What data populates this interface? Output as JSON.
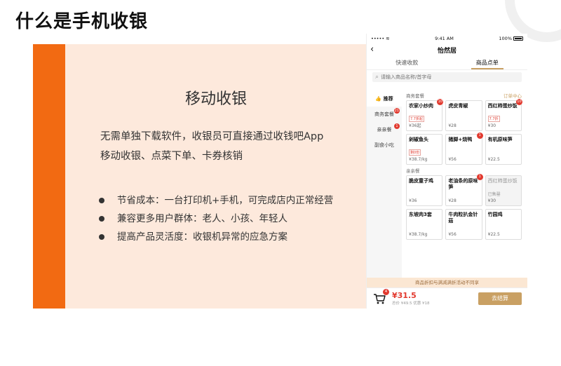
{
  "slide": {
    "title": "什么是手机收银"
  },
  "panel": {
    "heading": "移动收银",
    "desc_line1": "无需单独下载软件，收银员可直接通过收钱吧App",
    "desc_line2": "移动收银、点菜下单、卡券核销",
    "bullets": [
      "节省成本：一台打印机+手机，可完成店内正常经营",
      "兼容更多用户群体：老人、小孩、年轻人",
      "提高产品灵活度：收银机异常的应急方案"
    ]
  },
  "phone": {
    "status": {
      "carrier": "•••••",
      "time": "9:41 AM",
      "battery": "100%"
    },
    "nav": {
      "back": "‹",
      "title": "怡然居"
    },
    "tabs": [
      {
        "label": "快速收款"
      },
      {
        "label": "商品点单"
      }
    ],
    "search_placeholder": "请输入商品名称/首字母",
    "categories": [
      {
        "label": "推荐",
        "badge": ""
      },
      {
        "label": "商务套餐",
        "badge": "21"
      },
      {
        "label": "亲亲餐",
        "badge": "1"
      },
      {
        "label": "副食小吃",
        "badge": ""
      }
    ],
    "section1": {
      "title": "商务套餐",
      "link": "订单中心",
      "items": [
        {
          "name": "农家小炒肉",
          "tag": "7.7折起",
          "price": "¥36起",
          "badge": "10"
        },
        {
          "name": "虎皮青椒",
          "tag": "",
          "price": "¥28",
          "badge": ""
        },
        {
          "name": "西红柿蛋炒饭",
          "tag": "7.7折",
          "price": "¥30",
          "badge": "10"
        },
        {
          "name": "剁椒鱼头",
          "tag": "剩0份",
          "price": "¥38.7/kg",
          "badge": ""
        },
        {
          "name": "猪脚+烧鸭",
          "tag": "",
          "price": "¥56",
          "badge": "1"
        },
        {
          "name": "有机原味笋",
          "tag": "",
          "price": "¥22.5",
          "badge": ""
        }
      ]
    },
    "section2": {
      "title": "亲亲餐",
      "items": [
        {
          "name": "脆皮童子鸡",
          "tag": "",
          "price": "¥36",
          "badge": ""
        },
        {
          "name": "老油条的原味笋",
          "tag": "",
          "price": "¥28",
          "badge": "1"
        },
        {
          "name": "西红柿蛋炒饭",
          "tag": "已售罄",
          "price": "¥30",
          "badge": "",
          "disabled": true
        },
        {
          "name": "东坡肉3套",
          "tag": "",
          "price": "¥38.7/kg",
          "badge": ""
        },
        {
          "name": "牛肉粒扒金针菇",
          "tag": "",
          "price": "¥56",
          "badge": ""
        },
        {
          "name": "竹园鸡",
          "tag": "",
          "price": "¥22.5",
          "badge": ""
        }
      ]
    },
    "notice": "商品折扣与满减满折活动不同享",
    "cart": {
      "badge": "4",
      "total": "¥31.5",
      "sub": "总价 ¥49.5 优惠 ¥18",
      "checkout": "去结算"
    }
  }
}
